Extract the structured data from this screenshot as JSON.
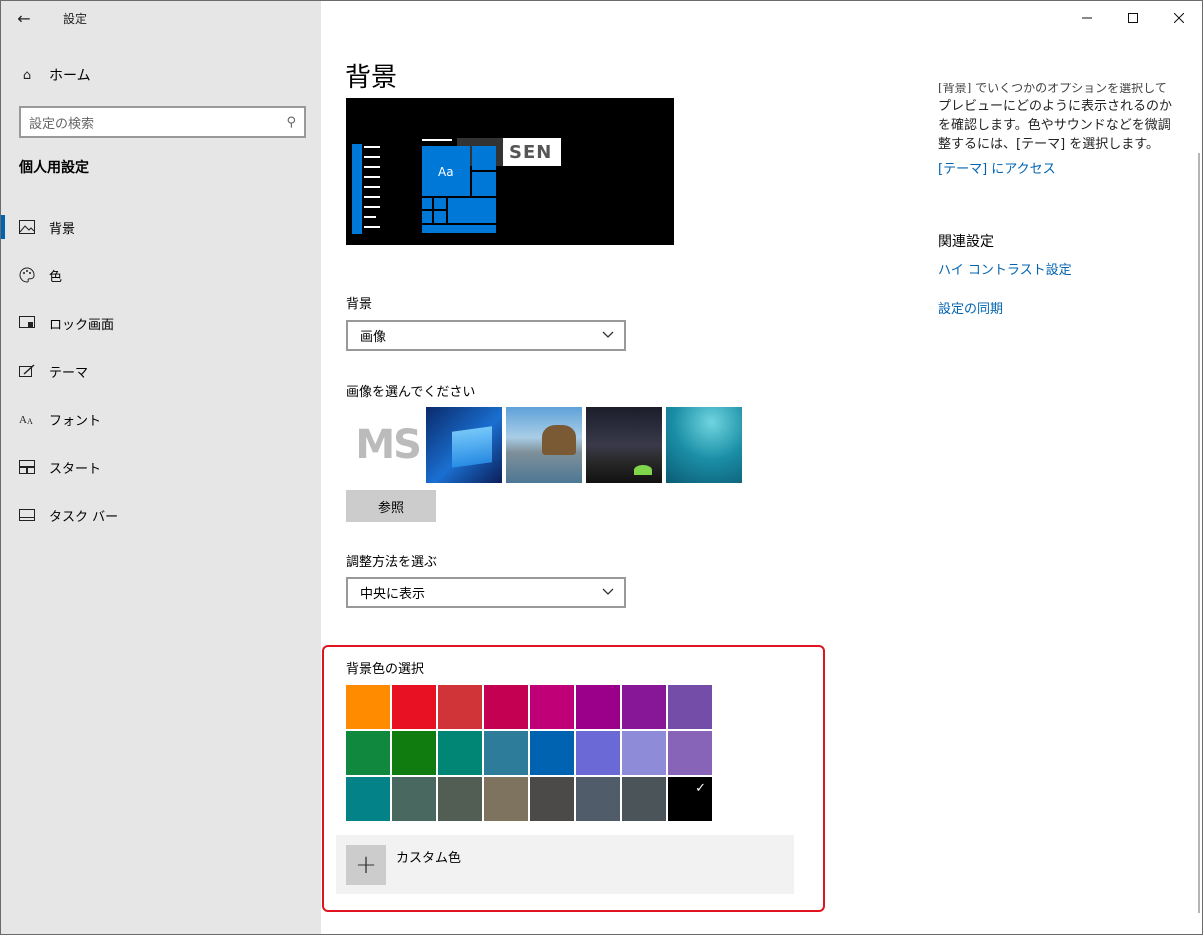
{
  "window": {
    "title": "設定",
    "controls": [
      "minimize-icon",
      "maximize-icon",
      "close-icon"
    ]
  },
  "sidebar": {
    "home_label": "ホーム",
    "search_placeholder": "設定の検索",
    "section_title": "個人用設定",
    "items": [
      {
        "label": "背景",
        "icon": "picture-icon",
        "active": true
      },
      {
        "label": "色",
        "icon": "palette-icon",
        "active": false
      },
      {
        "label": "ロック画面",
        "icon": "lock-screen-icon",
        "active": false
      },
      {
        "label": "テーマ",
        "icon": "theme-icon",
        "active": false
      },
      {
        "label": "フォント",
        "icon": "font-icon",
        "active": false
      },
      {
        "label": "スタート",
        "icon": "start-icon",
        "active": false
      },
      {
        "label": "タスク バー",
        "icon": "taskbar-icon",
        "active": false
      }
    ]
  },
  "main": {
    "title": "背景",
    "preview": {
      "tile_text": "Aa",
      "logo_text": "SEN"
    },
    "background_label": "背景",
    "background_value": "画像",
    "choose_picture_label": "画像を選んでください",
    "browse_label": "参照",
    "fit_label": "調整方法を選ぶ",
    "fit_value": "中央に表示",
    "color_label": "背景色の選択",
    "custom_color_label": "カスタム色",
    "thumbnail_ms_text": "MS",
    "colors": [
      "#ff8c00",
      "#e81123",
      "#d13438",
      "#c30052",
      "#bf0077",
      "#9a0089",
      "#881798",
      "#744da9",
      "#10893e",
      "#107c10",
      "#018574",
      "#2d7d9a",
      "#0063b1",
      "#6b69d6",
      "#8e8cd8",
      "#8764b8",
      "#038387",
      "#486860",
      "#525e54",
      "#7e735f",
      "#4c4a48",
      "#515c6b",
      "#4a5459",
      "#000000"
    ],
    "selected_color_index": 23
  },
  "right": {
    "clipped_line": "[背景] でいくつかのオプションを選択して",
    "description": "プレビューにどのように表示されるのかを確認します。色やサウンドなどを微調整するには、[テーマ] を選択します。",
    "theme_link": "[テーマ] にアクセス",
    "related_title": "関連設定",
    "related_links": [
      "ハイ コントラスト設定",
      "設定の同期"
    ]
  }
}
